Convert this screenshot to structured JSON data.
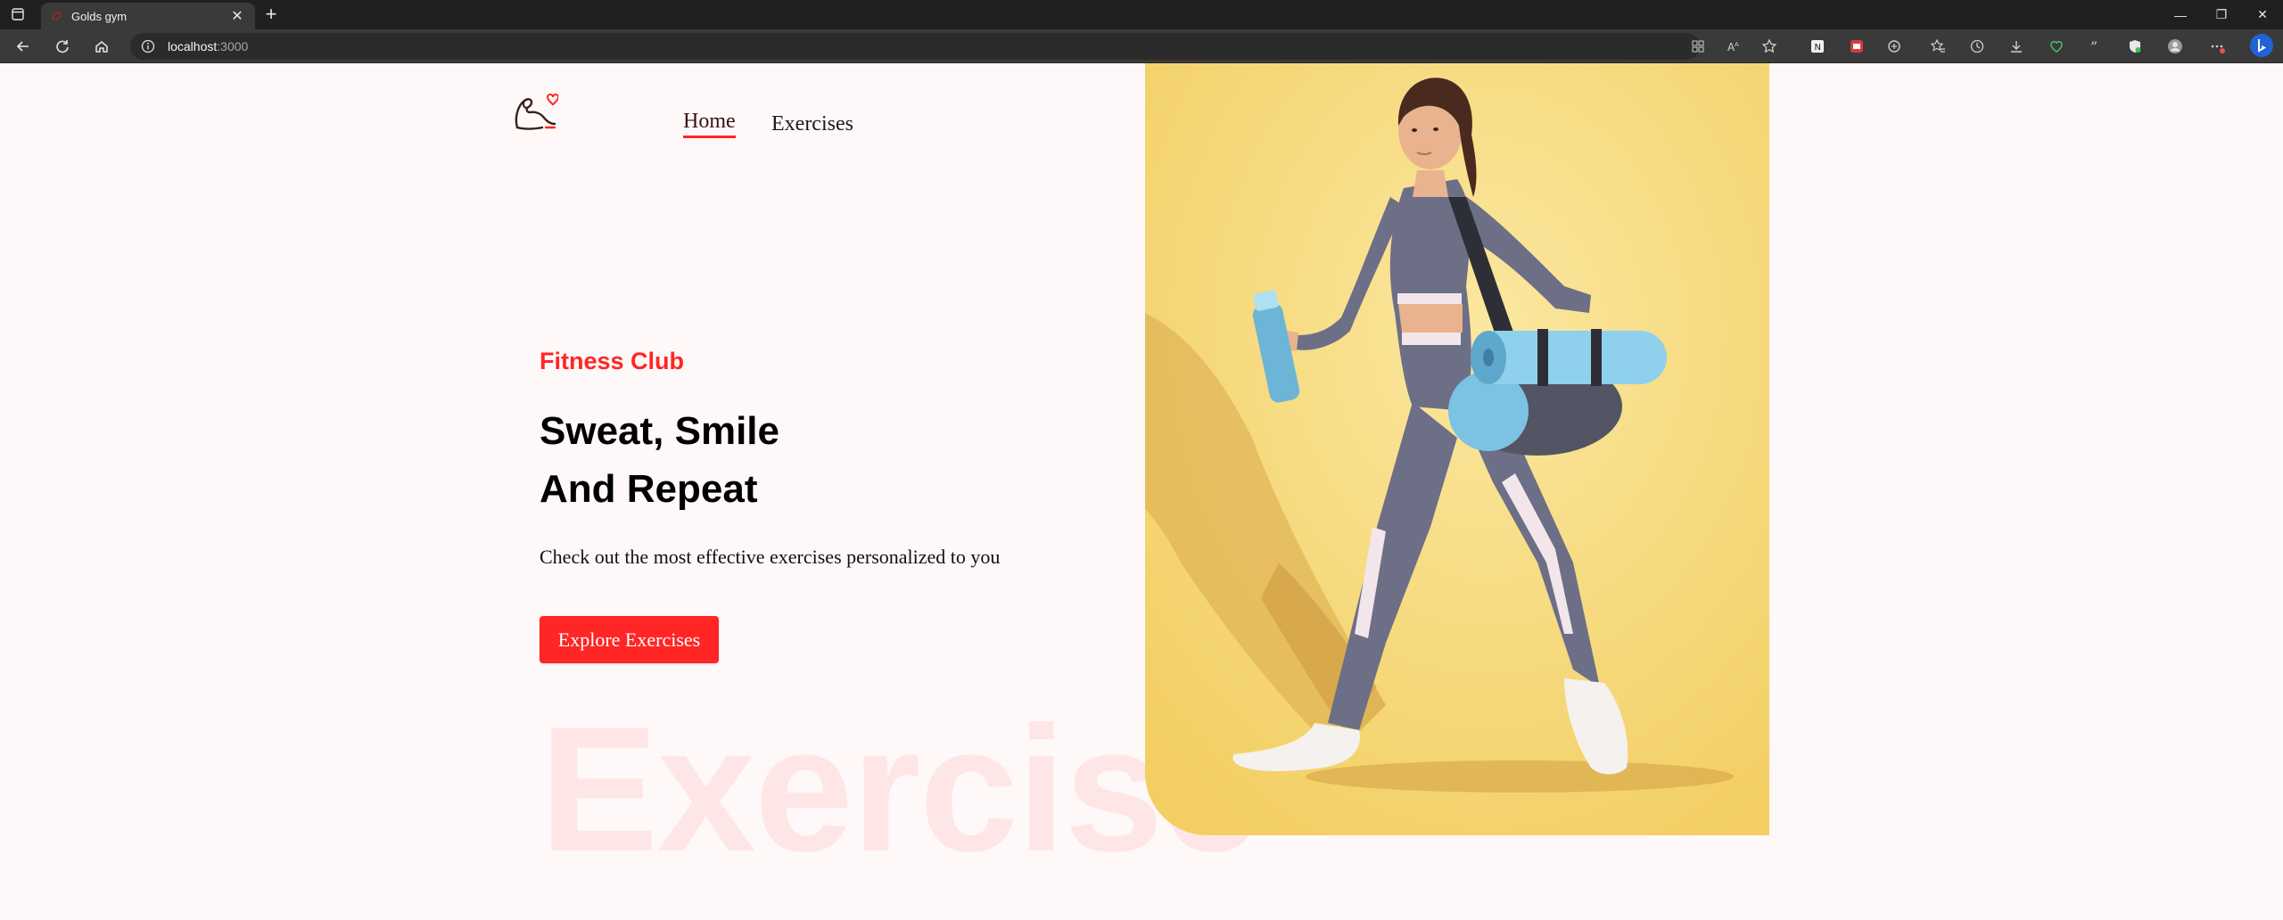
{
  "browser": {
    "tab_title": "Golds gym",
    "url_host": "localhost",
    "url_port": ":3000"
  },
  "nav": {
    "home": "Home",
    "exercises": "Exercises"
  },
  "hero": {
    "eyebrow": "Fitness Club",
    "headline_line1": "Sweat, Smile",
    "headline_line2": "And Repeat",
    "subcopy": "Check out the most effective exercises personalized to you",
    "cta": "Explore Exercises",
    "background_word": "Exercise"
  },
  "colors": {
    "accent": "#ff2625",
    "page_bg": "#fff8f8",
    "hero_bg": "#f6d978"
  },
  "icons": {
    "logo": "flexed-arm-heart-logo",
    "toolbar": [
      "back-icon",
      "refresh-icon",
      "home-icon",
      "site-info-icon",
      "apps-icon",
      "read-aloud-icon",
      "favorite-star-icon",
      "extension-icon",
      "favorites-icon",
      "history-icon",
      "downloads-icon",
      "performance-icon",
      "quote-icon",
      "shield-icon",
      "profile-icon",
      "more-icon",
      "copilot-icon"
    ]
  }
}
